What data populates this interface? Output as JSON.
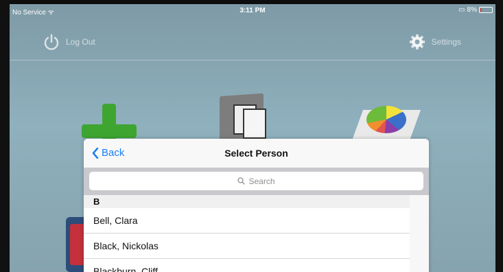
{
  "status": {
    "carrier": "No Service",
    "time": "3:11 PM",
    "battery": "8%"
  },
  "appbar": {
    "logout_label": "Log Out",
    "settings_label": "Settings"
  },
  "modal": {
    "back_label": "Back",
    "title": "Select Person",
    "search_placeholder": "Search",
    "section": "B",
    "people": [
      "Bell, Clara",
      "Black, Nickolas",
      "Blackburn, Cliff"
    ]
  },
  "colors": {
    "accent": "#1a7ef2",
    "background": "#8fb0bd"
  }
}
